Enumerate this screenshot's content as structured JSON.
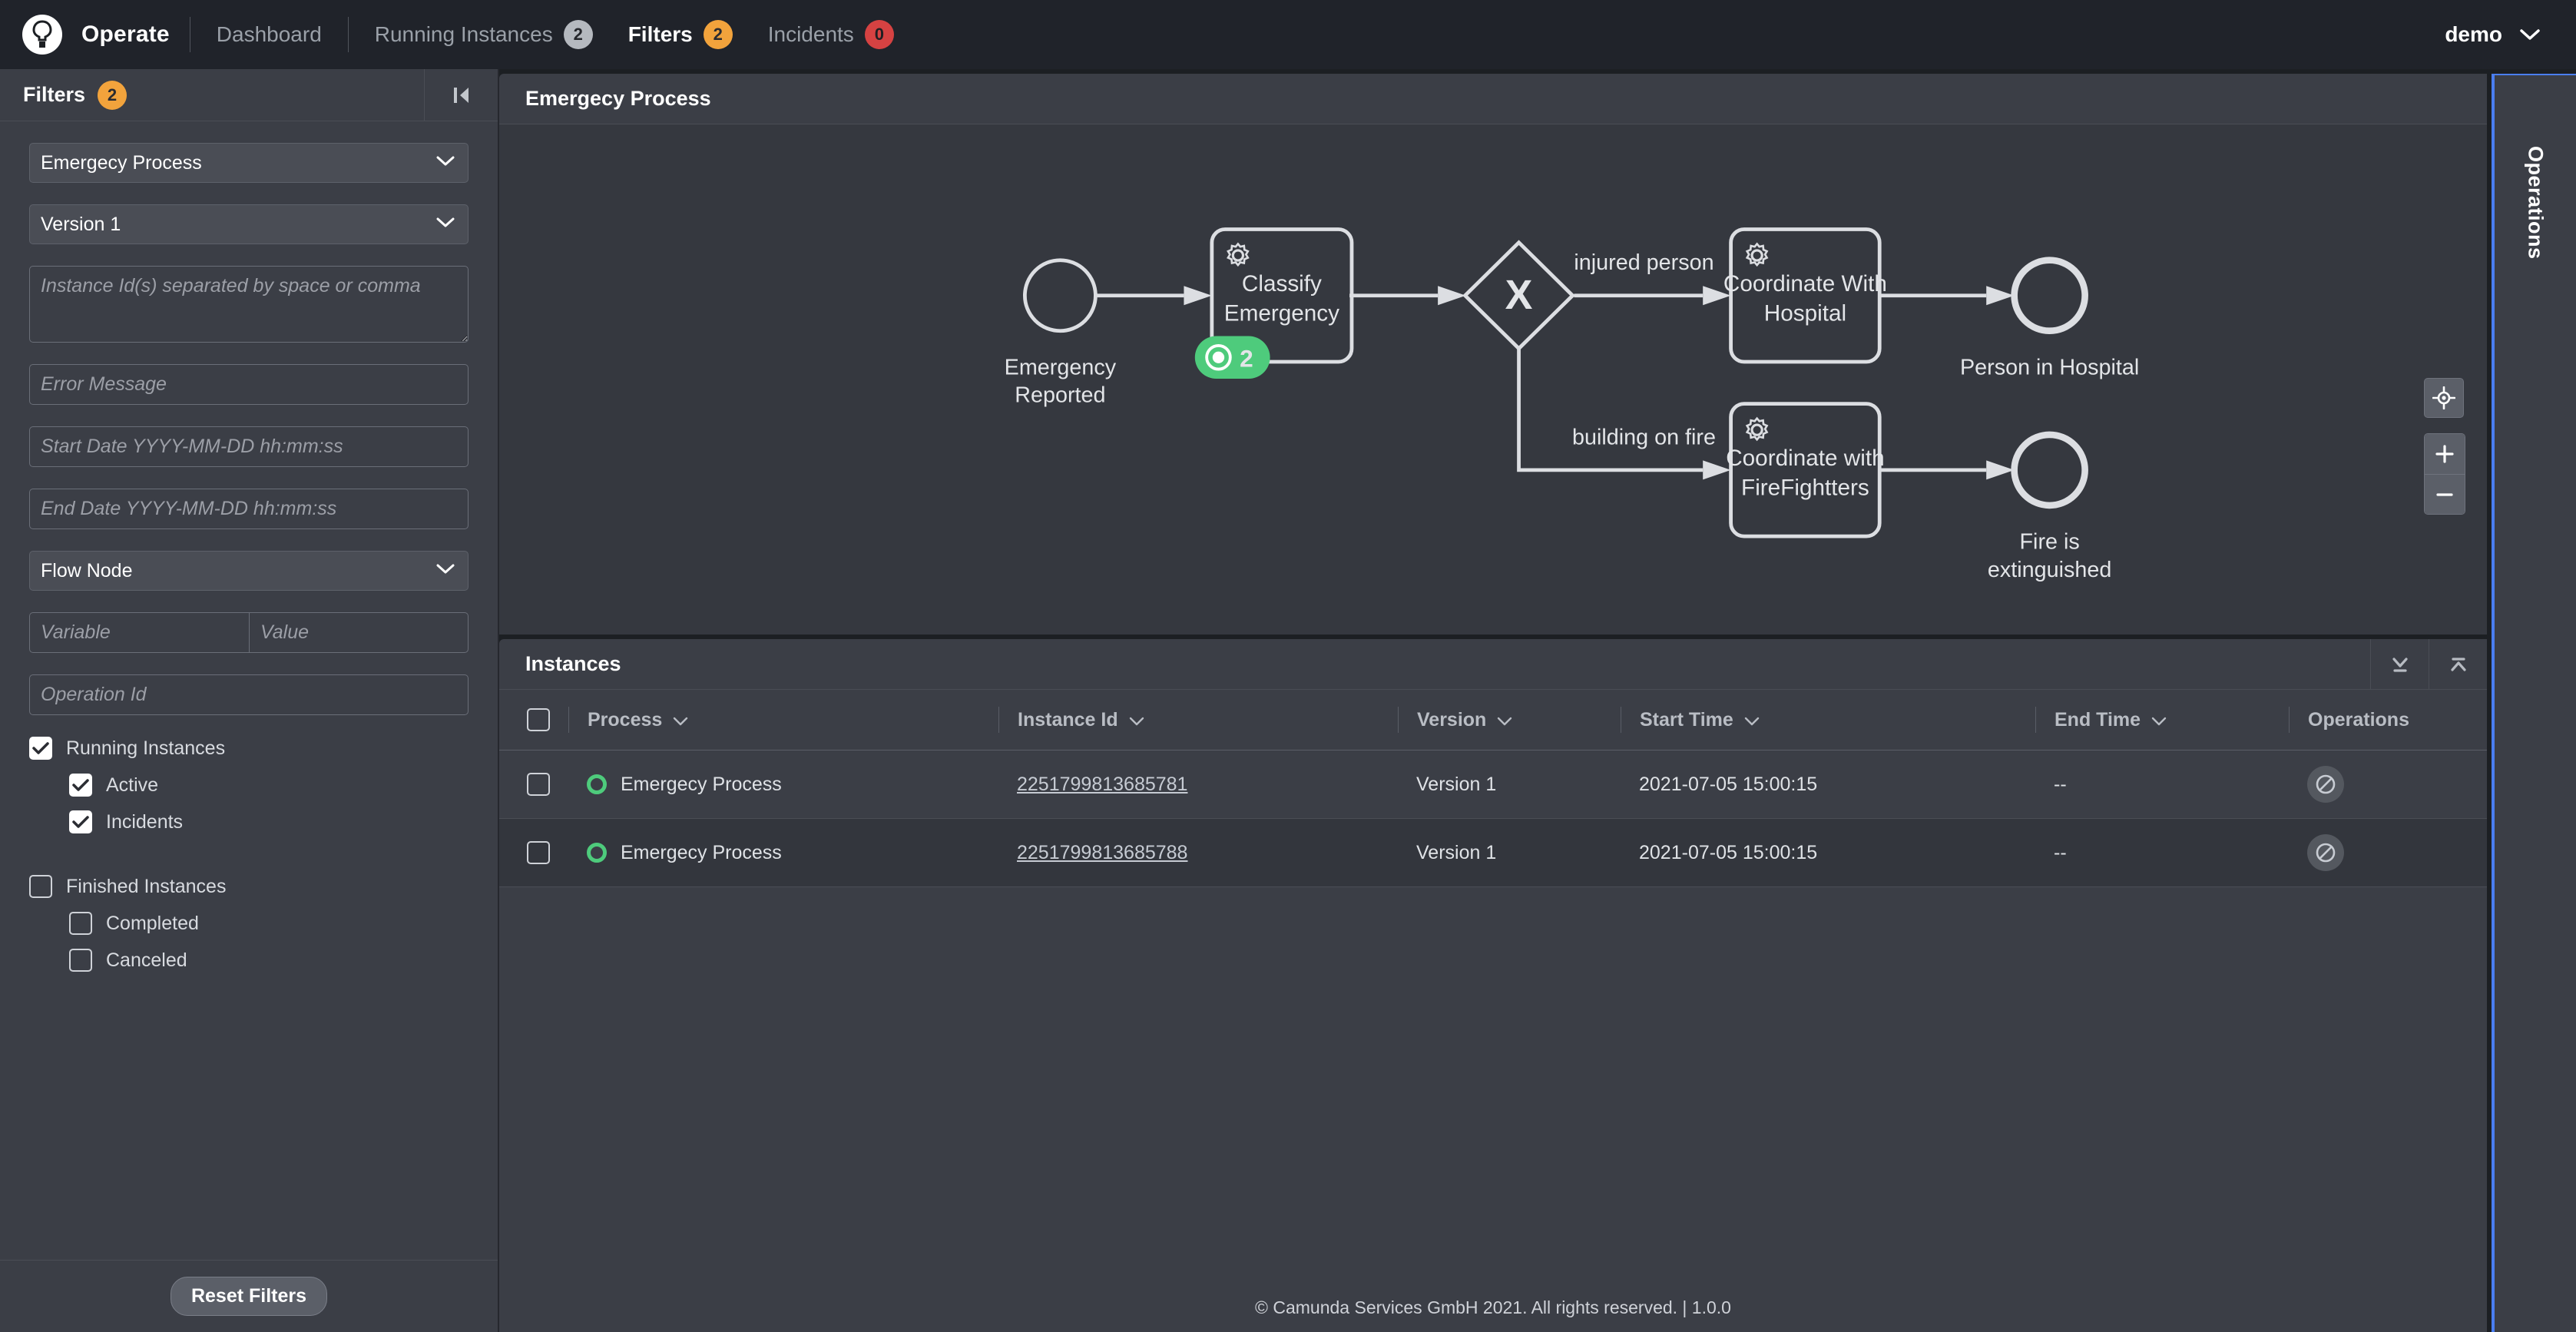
{
  "topnav": {
    "logo_icon": "camunda-logo-icon",
    "brand": "Operate",
    "items": [
      {
        "label": "Dashboard",
        "badge": null,
        "badge_color": null,
        "active": false
      },
      {
        "label": "Running Instances",
        "badge": "2",
        "badge_color": "#b5b9bf",
        "active": false
      },
      {
        "label": "Filters",
        "badge": "2",
        "badge_color": "#f2a33c",
        "active": true
      },
      {
        "label": "Incidents",
        "badge": "0",
        "badge_color": "#d64242",
        "active": false
      }
    ],
    "user": "demo",
    "user_chevron_icon": "chevron-down-icon"
  },
  "filters": {
    "title": "Filters",
    "count_badge": "2",
    "collapse_icon": "collapse-left-icon",
    "process_select": {
      "value": "Emergecy Process",
      "options": [
        "Emergecy Process"
      ]
    },
    "version_select": {
      "value": "Version 1",
      "options": [
        "Version 1"
      ]
    },
    "instance_ids": {
      "value": "",
      "placeholder": "Instance Id(s) separated by space or comma"
    },
    "error_message": {
      "value": "",
      "placeholder": "Error Message"
    },
    "start_date": {
      "value": "",
      "placeholder": "Start Date YYYY-MM-DD hh:mm:ss"
    },
    "end_date": {
      "value": "",
      "placeholder": "End Date YYYY-MM-DD hh:mm:ss"
    },
    "flow_node_select": {
      "value": "Flow Node",
      "options": [
        "Flow Node"
      ]
    },
    "variable": {
      "value": "",
      "placeholder": "Variable"
    },
    "variable_value": {
      "value": "",
      "placeholder": "Value"
    },
    "operation_id": {
      "value": "",
      "placeholder": "Operation Id"
    },
    "checkboxes": [
      {
        "label": "Running Instances",
        "checked": true,
        "indent": false
      },
      {
        "label": "Active",
        "checked": true,
        "indent": true
      },
      {
        "label": "Incidents",
        "checked": true,
        "indent": true
      },
      {
        "label": "Finished Instances",
        "checked": false,
        "indent": false
      },
      {
        "label": "Completed",
        "checked": false,
        "indent": true
      },
      {
        "label": "Canceled",
        "checked": false,
        "indent": true
      }
    ],
    "reset_label": "Reset Filters"
  },
  "diagram": {
    "title": "Emergecy Process",
    "reset_zoom_icon": "crosshair-icon",
    "zoom_in_icon": "plus-icon",
    "zoom_out_icon": "minus-icon",
    "nodes": {
      "start_event_label": "Emergency\nReported",
      "start_event_line1": "Emergency",
      "start_event_line2": "Reported",
      "task1_line1": "Classify",
      "task1_line2": "Emergency",
      "task1_icon": "service-task-gear-icon",
      "task1_instance_badge": "2",
      "task1_badge_color": "#4ecb7c",
      "gateway_symbol": "X",
      "flow_label_top": "injured person",
      "flow_label_bottom": "building on fire",
      "task2_line1": "Coordinate With",
      "task2_line2": "Hospital",
      "task2_icon": "service-task-gear-icon",
      "end1_line1": "Person in Hospital",
      "task3_line1": "Coordinate with",
      "task3_line2": "FireFightters",
      "task3_icon": "service-task-gear-icon",
      "end2_line1": "Fire is",
      "end2_line2": "extinguished"
    }
  },
  "instances": {
    "title": "Instances",
    "expand_icon": "expand-down-icon",
    "collapse_icon": "collapse-up-icon",
    "columns": [
      {
        "label": "Process",
        "sortable": true
      },
      {
        "label": "Instance Id",
        "sortable": true
      },
      {
        "label": "Version",
        "sortable": true
      },
      {
        "label": "Start Time",
        "sortable": true
      },
      {
        "label": "End Time",
        "sortable": true
      },
      {
        "label": "Operations",
        "sortable": false
      }
    ],
    "rows": [
      {
        "selected": false,
        "state": "active",
        "process": "Emergecy Process",
        "instance_id": "2251799813685781",
        "version": "Version 1",
        "start_time": "2021-07-05 15:00:15",
        "end_time": "--",
        "operation_icon": "cancel-operation-icon"
      },
      {
        "selected": false,
        "state": "active",
        "process": "Emergecy Process",
        "instance_id": "2251799813685788",
        "version": "Version 1",
        "start_time": "2021-07-05 15:00:15",
        "end_time": "--",
        "operation_icon": "cancel-operation-icon"
      }
    ]
  },
  "operations_rail": {
    "label": "Operations",
    "accent_color": "#4a7ef0"
  },
  "footer": {
    "text": "© Camunda Services GmbH 2021. All rights reserved. | 1.0.0"
  }
}
